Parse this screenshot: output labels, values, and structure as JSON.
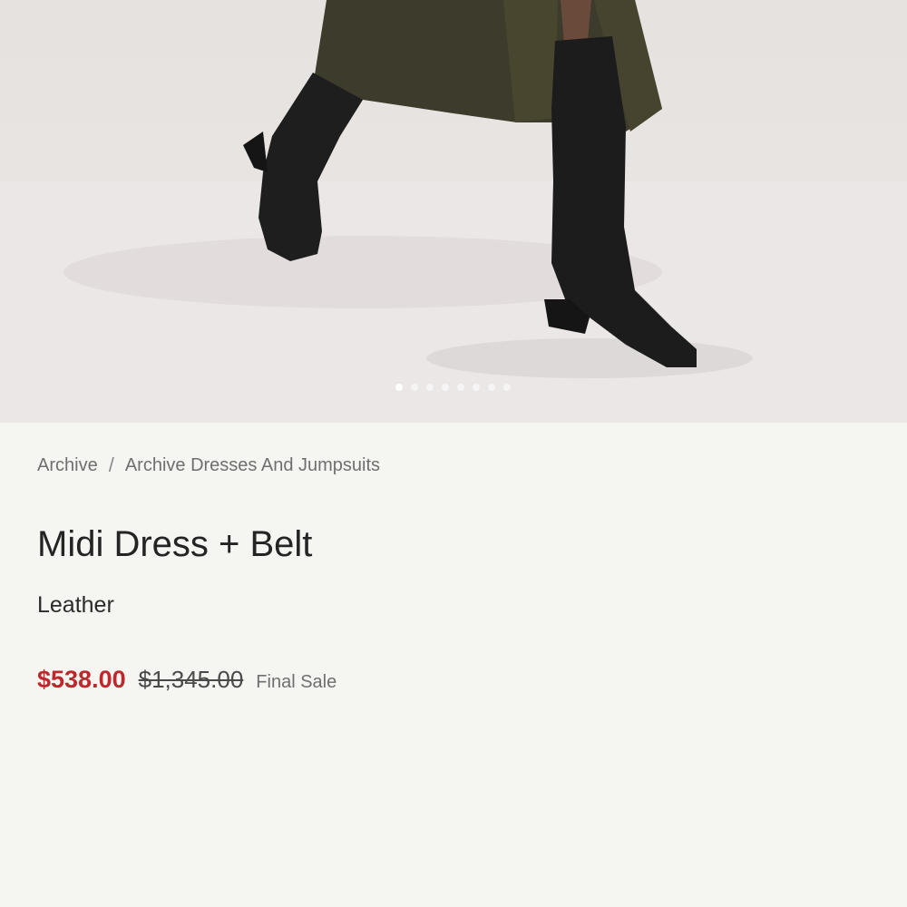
{
  "gallery": {
    "image_alt": "Model wearing black knee-high heeled leather boots and an olive leather midi dress",
    "slide_count": 8,
    "active_slide": 1
  },
  "breadcrumb": {
    "items": [
      "Archive",
      "Archive Dresses And Jumpsuits"
    ],
    "separator": "/"
  },
  "product": {
    "title": "Midi Dress + Belt",
    "material": "Leather",
    "sale_price": "$538.00",
    "original_price": "$1,345.00",
    "sale_note": "Final Sale"
  },
  "colors": {
    "sale_price": "#c0272d",
    "background": "#f5f5f1"
  }
}
